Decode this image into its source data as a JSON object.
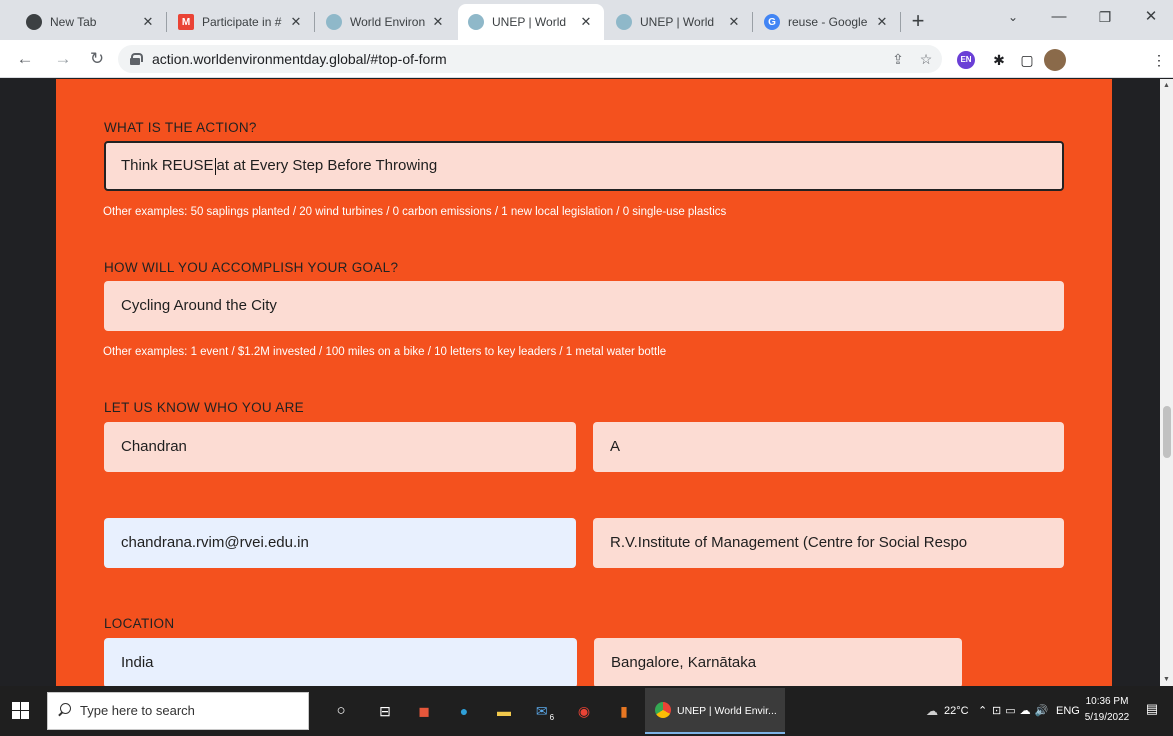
{
  "browser": {
    "tabs": [
      {
        "title": "New Tab",
        "favicon_color": "#3c4043"
      },
      {
        "title": "Participate in #",
        "favicon_color": "#ea4335"
      },
      {
        "title": "World Environ",
        "favicon_color": "#8fb8c9"
      },
      {
        "title": "UNEP | World",
        "favicon_color": "#8fb8c9",
        "active": true
      },
      {
        "title": "UNEP | World",
        "favicon_color": "#8fb8c9"
      },
      {
        "title": "reuse - Google",
        "favicon_color": "#4285f4"
      }
    ],
    "url": "action.worldenvironmentday.global/#top-of-form"
  },
  "form": {
    "action_label": "WHAT IS THE ACTION?",
    "action_value_before_caret": "Think REUSE",
    "action_value_after_caret": "at at Every Step  Before Throwing",
    "action_hint": "Other examples: 50 saplings planted / 20 wind turbines / 0 carbon emissions / 1 new local legislation / 0 single-use plastics",
    "goal_label": "HOW WILL YOU ACCOMPLISH YOUR GOAL?",
    "goal_value": "Cycling Around the City",
    "goal_hint": "Other examples: 1 event / $1.2M invested / 100 miles on a bike / 10 letters to key leaders / 1 metal water bottle",
    "who_label": "LET US KNOW WHO YOU ARE",
    "first_name": "Chandran",
    "last_name": "A",
    "email": "chandrana.rvim@rvei.edu.in",
    "organization": "R.V.Institute of Management (Centre for Social Respo",
    "location_label": "LOCATION",
    "country": "India",
    "city": "Bangalore, Karnātaka"
  },
  "taskbar": {
    "search_placeholder": "Type here to search",
    "active_window": "UNEP | World Envir...",
    "badge_count": "6",
    "temperature": "22°C",
    "language": "ENG",
    "time": "10:36 PM",
    "date": "5/19/2022"
  },
  "colors": {
    "panel": "#f4511e",
    "field": "#fcdcd3",
    "autofill": "#e8f0fe"
  }
}
